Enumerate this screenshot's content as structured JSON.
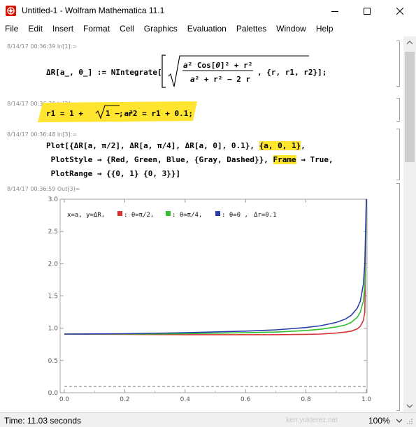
{
  "window": {
    "title": "Untitled-1 - Wolfram Mathematica 11.1",
    "icon": "mathematica-spikey-icon"
  },
  "menu": [
    "File",
    "Edit",
    "Insert",
    "Format",
    "Cell",
    "Graphics",
    "Evaluation",
    "Palettes",
    "Window",
    "Help"
  ],
  "cells": {
    "in1": {
      "label": "8/14/17 00:36:39 In[1]:=",
      "lhs": "ΔR[a_, θ_] := NIntegrate[",
      "num_a": "a",
      "num_mid": "² Cos[",
      "num_theta": "θ",
      "num_end": "]² + r²",
      "den_a": "a",
      "den_rest": "² + r² − 2 r",
      "tail": ", {r, r1, r2}];"
    },
    "in2": {
      "label": "8/14/17 00:36:39 In[2]:=",
      "pre": "r1 = 1 + ",
      "sqrt_arg": "1 − a²",
      "post": "; r2 = r1 + 0.1;"
    },
    "in3": {
      "label": "8/14/17 00:36:48 In[3]:=",
      "line1_pre": "Plot[{ΔR[a, π/2], ΔR[a, π/4], ΔR[a, 0], 0.1}, ",
      "line1_hl": "{a, 0, 1}",
      "line1_post": ",",
      "line2_pre": " PlotStyle → {Red, Green, Blue, {Gray, Dashed}}, ",
      "line2_hl": "Frame",
      "line2_post": " → True,",
      "line3": " PlotRange → {{0, 1} {0, 3}}]"
    },
    "out3": {
      "label": "8/14/17 00:36:59 Out[3]="
    }
  },
  "chart_data": {
    "type": "line",
    "title": "",
    "xlabel": "",
    "ylabel": "",
    "xlim": [
      0,
      1
    ],
    "ylim": [
      0,
      3
    ],
    "x_ticks": [
      "0.0",
      "0.2",
      "0.4",
      "0.6",
      "0.8",
      "1.0"
    ],
    "y_ticks": [
      "0.0",
      "0.5",
      "1.0",
      "1.5",
      "2.0",
      "2.5",
      "3.0"
    ],
    "grid": false,
    "legend_position": "top-left",
    "legend": {
      "prefix": "x=a, y=ΔR,",
      "entries": [
        {
          "label": ": θ=π/2,",
          "color": "#d93030"
        },
        {
          "label": ": θ=π/4,",
          "color": "#30c030"
        },
        {
          "label": ": θ=0 ,",
          "color": "#2a3dab"
        }
      ],
      "suffix": "Δr=0.1"
    },
    "series": [
      {
        "color": "#d93030",
        "x": [
          0,
          0.2,
          0.4,
          0.6,
          0.7,
          0.8,
          0.85,
          0.9,
          0.93,
          0.95,
          0.97,
          0.98,
          0.99,
          0.995,
          1.0
        ],
        "y": [
          0.91,
          0.905,
          0.9,
          0.9,
          0.9,
          0.905,
          0.91,
          0.925,
          0.94,
          0.955,
          0.99,
          1.03,
          1.12,
          1.25,
          3.0
        ]
      },
      {
        "color": "#30c030",
        "x": [
          0,
          0.2,
          0.4,
          0.6,
          0.7,
          0.8,
          0.85,
          0.9,
          0.93,
          0.95,
          0.97,
          0.98,
          0.99,
          0.995,
          1.0
        ],
        "y": [
          0.91,
          0.91,
          0.915,
          0.93,
          0.94,
          0.965,
          0.985,
          1.02,
          1.05,
          1.09,
          1.17,
          1.25,
          1.42,
          1.65,
          3.0
        ]
      },
      {
        "color": "#2a3dab",
        "x": [
          0,
          0.2,
          0.4,
          0.6,
          0.7,
          0.8,
          0.85,
          0.9,
          0.93,
          0.95,
          0.97,
          0.98,
          0.99,
          0.995,
          1.0
        ],
        "y": [
          0.91,
          0.915,
          0.93,
          0.955,
          0.975,
          1.01,
          1.04,
          1.09,
          1.14,
          1.2,
          1.31,
          1.42,
          1.68,
          2.0,
          3.0
        ]
      },
      {
        "color": "#808080",
        "dashed": true,
        "x": [
          0,
          1
        ],
        "y": [
          0.1,
          0.1
        ]
      }
    ]
  },
  "status": {
    "left": "Time: 11.03 seconds",
    "watermark": "kerr.yukterez.net",
    "zoom": "100%"
  }
}
